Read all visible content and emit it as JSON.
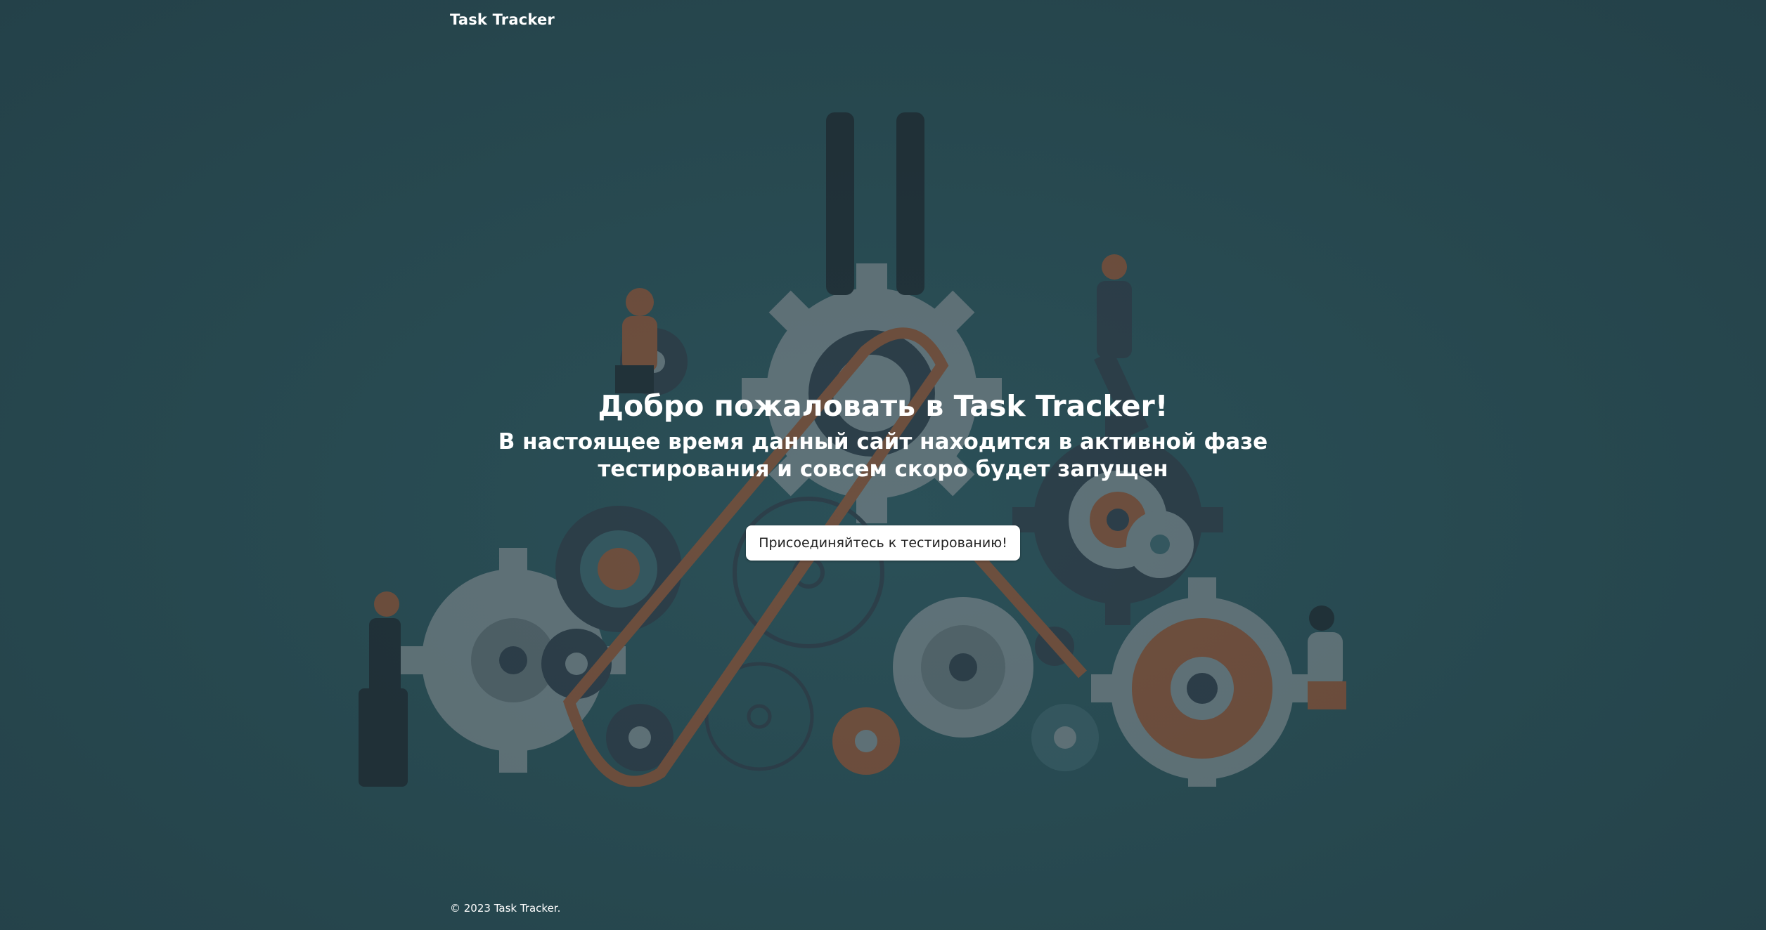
{
  "header": {
    "brand": "Task Tracker"
  },
  "hero": {
    "title": "Добро пожаловать в Task Tracker!",
    "subtitle": "В настоящее время данный сайт находится в активной фазе тестирования и совсем скоро будет запущен",
    "cta_label": "Присоединяйтесь к тестированию!"
  },
  "footer": {
    "copyright": "© 2023 Task Tracker."
  },
  "colors": {
    "background": "#27474f",
    "gear_gray": "#7a7f84",
    "gear_dark": "#2f3340",
    "gear_orange": "#a3502c",
    "button_bg": "#ffffff"
  }
}
